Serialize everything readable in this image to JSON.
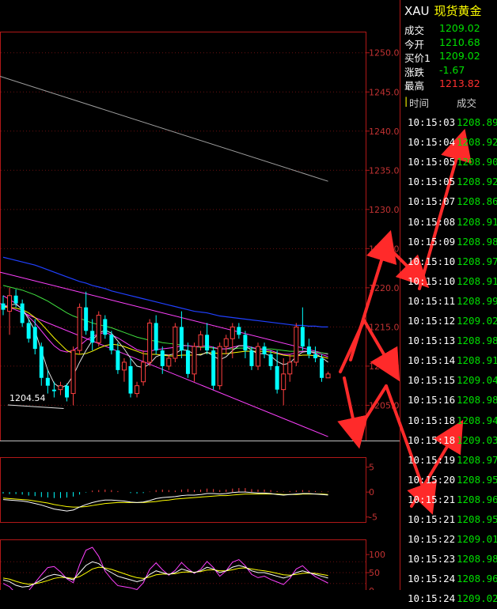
{
  "header": {
    "code": "XAU",
    "name": "现货黄金"
  },
  "quote": [
    {
      "label": "成交",
      "value": "1209.02",
      "color": "#00e000"
    },
    {
      "label": "今开",
      "value": "1210.68",
      "color": "#00e000"
    },
    {
      "label": "买价1",
      "value": "1209.02",
      "color": "#00e000"
    },
    {
      "label": "涨跌",
      "value": "-1.67",
      "color": "#00e000"
    },
    {
      "label": "最高",
      "value": "1213.82",
      "color": "#ff3030"
    }
  ],
  "trades_header": {
    "time": "时间",
    "price": "成交"
  },
  "trades": [
    {
      "time": "10:15:03",
      "price": "1208.89"
    },
    {
      "time": "10:15:04",
      "price": "1208.92"
    },
    {
      "time": "10:15:05",
      "price": "1208.90"
    },
    {
      "time": "10:15:05",
      "price": "1208.92"
    },
    {
      "time": "10:15:07",
      "price": "1208.86"
    },
    {
      "time": "10:15:08",
      "price": "1208.91"
    },
    {
      "time": "10:15:09",
      "price": "1208.98"
    },
    {
      "time": "10:15:10",
      "price": "1208.97"
    },
    {
      "time": "10:15:10",
      "price": "1208.91"
    },
    {
      "time": "10:15:11",
      "price": "1208.99"
    },
    {
      "time": "10:15:12",
      "price": "1209.02"
    },
    {
      "time": "10:15:13",
      "price": "1208.98"
    },
    {
      "time": "10:15:14",
      "price": "1208.91"
    },
    {
      "time": "10:15:15",
      "price": "1209.04"
    },
    {
      "time": "10:15:16",
      "price": "1208.98"
    },
    {
      "time": "10:15:18",
      "price": "1208.94"
    },
    {
      "time": "10:15:18",
      "price": "1209.03"
    },
    {
      "time": "10:15:19",
      "price": "1208.97"
    },
    {
      "time": "10:15:20",
      "price": "1208.95"
    },
    {
      "time": "10:15:21",
      "price": "1208.96"
    },
    {
      "time": "10:15:21",
      "price": "1208.95"
    },
    {
      "time": "10:15:22",
      "price": "1209.01"
    },
    {
      "time": "10:15:23",
      "price": "1208.98"
    },
    {
      "time": "10:15:24",
      "price": "1208.96"
    },
    {
      "time": "10:15:24",
      "price": "1209.02"
    }
  ],
  "chart_data": {
    "type": "candlestick",
    "price_axis": {
      "ticks": [
        "1250.0",
        "1245.0",
        "1240.0",
        "1235.0",
        "1230.0",
        "1225.0",
        "1220.0",
        "1215.0",
        "1210.0",
        "1205.0"
      ],
      "range": [
        1200.5,
        1252.7
      ]
    },
    "low_annotation": "1204.54",
    "macd_axis": {
      "ticks": [
        "5",
        "0",
        "-5"
      ]
    },
    "kdj_axis": {
      "ticks": [
        "100",
        "50",
        "0"
      ]
    },
    "colors": {
      "up": "#ff4040",
      "down": "#00ffff",
      "axis": "#b01818",
      "ma_white": "#e0e0e0",
      "ma_yellow": "#ffff00",
      "ma_green": "#40e040",
      "ma_blue": "#2040ff",
      "ma_magenta": "#ff40ff",
      "ma_grey": "#a0a0a0",
      "arrow": "#ff2a2a"
    },
    "candles": [
      {
        "o": 1218.0,
        "h": 1219.0,
        "l": 1216.5,
        "c": 1217.2
      },
      {
        "o": 1217.0,
        "h": 1220.0,
        "l": 1214.0,
        "c": 1219.0
      },
      {
        "o": 1219.0,
        "h": 1219.8,
        "l": 1217.5,
        "c": 1218.0
      },
      {
        "o": 1218.0,
        "h": 1218.5,
        "l": 1215.0,
        "c": 1215.5
      },
      {
        "o": 1215.5,
        "h": 1216.0,
        "l": 1213.0,
        "c": 1213.5
      },
      {
        "o": 1215.0,
        "h": 1216.0,
        "l": 1211.5,
        "c": 1212.2
      },
      {
        "o": 1212.5,
        "h": 1213.0,
        "l": 1207.5,
        "c": 1208.5
      },
      {
        "o": 1208.5,
        "h": 1209.5,
        "l": 1206.5,
        "c": 1207.5
      },
      {
        "o": 1207.0,
        "h": 1208.0,
        "l": 1206.0,
        "c": 1206.8
      },
      {
        "o": 1207.0,
        "h": 1208.0,
        "l": 1206.3,
        "c": 1207.5
      },
      {
        "o": 1207.5,
        "h": 1207.8,
        "l": 1205.5,
        "c": 1206.0
      },
      {
        "o": 1206.5,
        "h": 1212.5,
        "l": 1205.0,
        "c": 1212.0
      },
      {
        "o": 1212.0,
        "h": 1218.0,
        "l": 1211.5,
        "c": 1217.5
      },
      {
        "o": 1217.5,
        "h": 1219.5,
        "l": 1214.0,
        "c": 1214.5
      },
      {
        "o": 1214.5,
        "h": 1216.0,
        "l": 1212.0,
        "c": 1213.0
      },
      {
        "o": 1213.0,
        "h": 1217.0,
        "l": 1212.5,
        "c": 1216.5
      },
      {
        "o": 1216.0,
        "h": 1216.5,
        "l": 1213.5,
        "c": 1214.0
      },
      {
        "o": 1214.0,
        "h": 1214.5,
        "l": 1211.5,
        "c": 1212.0
      },
      {
        "o": 1212.0,
        "h": 1213.0,
        "l": 1209.0,
        "c": 1209.5
      },
      {
        "o": 1209.5,
        "h": 1211.0,
        "l": 1208.0,
        "c": 1210.5
      },
      {
        "o": 1210.0,
        "h": 1211.0,
        "l": 1206.0,
        "c": 1206.5
      },
      {
        "o": 1206.5,
        "h": 1208.0,
        "l": 1206.0,
        "c": 1207.5
      },
      {
        "o": 1208.0,
        "h": 1212.0,
        "l": 1207.5,
        "c": 1210.5
      },
      {
        "o": 1210.5,
        "h": 1216.0,
        "l": 1210.0,
        "c": 1215.5
      },
      {
        "o": 1215.5,
        "h": 1216.5,
        "l": 1211.5,
        "c": 1212.0
      },
      {
        "o": 1212.0,
        "h": 1212.5,
        "l": 1209.0,
        "c": 1210.0
      },
      {
        "o": 1210.0,
        "h": 1211.5,
        "l": 1209.5,
        "c": 1211.0
      },
      {
        "o": 1211.0,
        "h": 1215.5,
        "l": 1210.5,
        "c": 1215.0
      },
      {
        "o": 1215.0,
        "h": 1217.0,
        "l": 1211.0,
        "c": 1212.0
      },
      {
        "o": 1212.0,
        "h": 1213.0,
        "l": 1208.5,
        "c": 1209.0
      },
      {
        "o": 1209.0,
        "h": 1213.0,
        "l": 1208.0,
        "c": 1212.5
      },
      {
        "o": 1212.5,
        "h": 1214.5,
        "l": 1212.0,
        "c": 1214.0
      },
      {
        "o": 1214.0,
        "h": 1215.5,
        "l": 1211.5,
        "c": 1212.0
      },
      {
        "o": 1212.0,
        "h": 1212.5,
        "l": 1207.0,
        "c": 1207.5
      },
      {
        "o": 1207.5,
        "h": 1213.0,
        "l": 1207.0,
        "c": 1212.5
      },
      {
        "o": 1212.5,
        "h": 1214.0,
        "l": 1211.5,
        "c": 1213.5
      },
      {
        "o": 1213.5,
        "h": 1215.5,
        "l": 1211.0,
        "c": 1215.0
      },
      {
        "o": 1215.0,
        "h": 1215.5,
        "l": 1213.5,
        "c": 1214.0
      },
      {
        "o": 1214.0,
        "h": 1214.5,
        "l": 1211.0,
        "c": 1212.0
      },
      {
        "o": 1212.0,
        "h": 1212.5,
        "l": 1209.5,
        "c": 1210.0
      },
      {
        "o": 1210.0,
        "h": 1213.0,
        "l": 1209.5,
        "c": 1212.5
      },
      {
        "o": 1212.5,
        "h": 1213.0,
        "l": 1211.0,
        "c": 1211.5
      },
      {
        "o": 1211.5,
        "h": 1212.0,
        "l": 1209.5,
        "c": 1210.0
      },
      {
        "o": 1210.0,
        "h": 1212.0,
        "l": 1206.5,
        "c": 1207.0
      },
      {
        "o": 1207.0,
        "h": 1211.0,
        "l": 1205.0,
        "c": 1209.0
      },
      {
        "o": 1209.0,
        "h": 1211.5,
        "l": 1208.0,
        "c": 1210.5
      },
      {
        "o": 1210.5,
        "h": 1215.5,
        "l": 1210.0,
        "c": 1215.0
      },
      {
        "o": 1215.0,
        "h": 1217.5,
        "l": 1212.0,
        "c": 1212.5
      },
      {
        "o": 1212.5,
        "h": 1213.5,
        "l": 1211.0,
        "c": 1211.5
      },
      {
        "o": 1211.5,
        "h": 1212.5,
        "l": 1210.5,
        "c": 1211.0
      },
      {
        "o": 1211.0,
        "h": 1211.5,
        "l": 1208.0,
        "c": 1208.5
      },
      {
        "o": 1208.5,
        "h": 1209.3,
        "l": 1208.5,
        "c": 1209.0
      }
    ],
    "ma_white": [
      1217.5,
      1217.8,
      1217.9,
      1217.3,
      1216.0,
      1214.5,
      1212.0,
      1209.5,
      1207.8,
      1207.2,
      1207.6,
      1208.8,
      1210.5,
      1212.0,
      1213.3,
      1214.2,
      1214.6,
      1214.2,
      1213.2,
      1212.2,
      1211.0,
      1210.0,
      1209.8,
      1210.3,
      1211.2,
      1211.5,
      1211.4,
      1211.6,
      1212.1,
      1212.0,
      1211.5,
      1211.4,
      1211.8,
      1211.3,
      1210.8,
      1211.2,
      1212.0,
      1212.6,
      1212.6,
      1212.0,
      1211.6,
      1211.6,
      1211.3,
      1210.6,
      1210.2,
      1210.4,
      1211.2,
      1211.8,
      1211.9,
      1211.6,
      1211.1,
      1210.5
    ],
    "ma_yellow": [
      1217.5,
      1217.5,
      1217.4,
      1217.2,
      1216.8,
      1216.2,
      1215.4,
      1214.5,
      1213.6,
      1212.8,
      1212.0,
      1211.6,
      1211.5,
      1211.6,
      1211.9,
      1212.3,
      1212.6,
      1212.8,
      1212.7,
      1212.5,
      1212.2,
      1211.9,
      1211.6,
      1211.5,
      1211.5,
      1211.4,
      1211.3,
      1211.3,
      1211.4,
      1211.4,
      1211.4,
      1211.5,
      1211.7,
      1211.7,
      1211.6,
      1211.6,
      1211.7,
      1211.8,
      1211.9,
      1211.9,
      1211.9,
      1211.9,
      1211.8,
      1211.6,
      1211.4,
      1211.3,
      1211.3,
      1211.4,
      1211.4,
      1211.3,
      1211.2,
      1211.0
    ],
    "ma_green": [
      1220.3,
      1220.1,
      1219.9,
      1219.7,
      1219.4,
      1219.1,
      1218.7,
      1218.3,
      1217.8,
      1217.3,
      1216.8,
      1216.4,
      1216.1,
      1215.8,
      1215.5,
      1215.3,
      1215.1,
      1214.9,
      1214.6,
      1214.3,
      1214.0,
      1213.7,
      1213.5,
      1213.3,
      1213.2,
      1213.0,
      1212.9,
      1212.8,
      1212.7,
      1212.6,
      1212.5,
      1212.4,
      1212.4,
      1212.3,
      1212.2,
      1212.2,
      1212.2,
      1212.3,
      1212.3,
      1212.3,
      1212.2,
      1212.2,
      1212.2,
      1212.1,
      1212.0,
      1211.9,
      1211.9,
      1211.9,
      1211.9,
      1211.8,
      1211.7,
      1211.6
    ],
    "ma_blue": [
      1223.9,
      1223.7,
      1223.5,
      1223.3,
      1223.1,
      1222.9,
      1222.6,
      1222.3,
      1222.0,
      1221.7,
      1221.4,
      1221.1,
      1220.8,
      1220.6,
      1220.3,
      1220.1,
      1219.9,
      1219.6,
      1219.4,
      1219.2,
      1219.0,
      1218.8,
      1218.6,
      1218.4,
      1218.2,
      1218.0,
      1217.8,
      1217.6,
      1217.4,
      1217.2,
      1217.0,
      1216.9,
      1216.8,
      1216.6,
      1216.4,
      1216.3,
      1216.2,
      1216.1,
      1216.0,
      1215.9,
      1215.8,
      1215.7,
      1215.6,
      1215.5,
      1215.4,
      1215.3,
      1215.2,
      1215.2,
      1215.1,
      1215.1,
      1215.0,
      1215.0
    ],
    "ma_magenta": [
      1219.0,
      1218.5,
      1218.0,
      1217.2,
      1216.3,
      1215.5,
      1214.5,
      1213.5,
      1212.6,
      1212.0,
      1211.8,
      1212.0,
      1212.6,
      1213.3,
      1213.8,
      1214.1,
      1214.3,
      1214.0,
      1213.6,
      1213.1,
      1212.6,
      1212.1,
      1211.9,
      1211.9,
      1212.1,
      1212.2,
      1212.3,
      1212.4,
      1212.6,
      1212.6,
      1212.5,
      1212.5,
      1212.6,
      1212.4,
      1212.2,
      1212.2,
      1212.4,
      1212.6,
      1212.6,
      1212.4,
      1212.2,
      1212.1,
      1212.0,
      1211.7,
      1211.5,
      1211.5,
      1211.7,
      1211.9,
      1211.9,
      1211.7,
      1211.5,
      1211.2
    ],
    "ma_grey_line": [
      {
        "x": 0,
        "y": 1247.0
      },
      {
        "x": 51,
        "y": 1233.6
      }
    ],
    "trendlines": [
      {
        "color": "#ff40ff",
        "from": {
          "x": 0,
          "y": 1222.0
        },
        "to": {
          "x": 51,
          "y": 1211.5
        }
      },
      {
        "color": "#ff40ff",
        "from": {
          "x": 0,
          "y": 1218.0
        },
        "to": {
          "x": 51,
          "y": 1201.0
        }
      }
    ],
    "macd_hist": [
      -0.3,
      -0.4,
      -0.4,
      -0.5,
      -0.7,
      -0.8,
      -1.0,
      -1.1,
      -1.2,
      -1.2,
      -1.1,
      -0.9,
      -0.5,
      -0.1,
      0.3,
      0.4,
      0.5,
      0.4,
      0.2,
      0.0,
      -0.2,
      -0.3,
      -0.2,
      0.1,
      0.4,
      0.5,
      0.4,
      0.3,
      0.5,
      0.6,
      0.4,
      0.5,
      0.7,
      0.6,
      0.4,
      0.5,
      0.7,
      0.8,
      0.8,
      0.6,
      0.5,
      0.5,
      0.4,
      0.2,
      0.1,
      0.2,
      0.3,
      0.4,
      0.3,
      0.2,
      0.1,
      0.1
    ],
    "macd_dif": [
      -1.5,
      -1.6,
      -1.7,
      -1.8,
      -2.0,
      -2.3,
      -2.6,
      -3.0,
      -3.4,
      -3.6,
      -3.8,
      -3.6,
      -3.0,
      -2.5,
      -2.1,
      -1.8,
      -1.6,
      -1.6,
      -1.7,
      -1.8,
      -2.0,
      -2.1,
      -2.0,
      -1.7,
      -1.3,
      -1.1,
      -1.0,
      -0.9,
      -0.7,
      -0.6,
      -0.6,
      -0.5,
      -0.3,
      -0.3,
      -0.4,
      -0.3,
      -0.1,
      0.0,
      0.0,
      -0.1,
      -0.2,
      -0.2,
      -0.3,
      -0.5,
      -0.6,
      -0.5,
      -0.4,
      -0.3,
      -0.3,
      -0.4,
      -0.5,
      -0.6
    ],
    "macd_dea": [
      -1.2,
      -1.3,
      -1.4,
      -1.5,
      -1.6,
      -1.8,
      -2.0,
      -2.2,
      -2.5,
      -2.7,
      -2.9,
      -3.0,
      -3.0,
      -2.9,
      -2.7,
      -2.5,
      -2.3,
      -2.2,
      -2.1,
      -2.1,
      -2.1,
      -2.1,
      -2.1,
      -2.0,
      -1.9,
      -1.7,
      -1.6,
      -1.4,
      -1.3,
      -1.2,
      -1.1,
      -1.0,
      -0.9,
      -0.8,
      -0.7,
      -0.7,
      -0.6,
      -0.5,
      -0.4,
      -0.4,
      -0.4,
      -0.4,
      -0.4,
      -0.4,
      -0.5,
      -0.5,
      -0.5,
      -0.4,
      -0.4,
      -0.4,
      -0.4,
      -0.5
    ],
    "kdj_k": [
      30,
      25,
      15,
      10,
      12,
      20,
      30,
      40,
      45,
      42,
      35,
      30,
      50,
      70,
      80,
      75,
      60,
      50,
      40,
      35,
      30,
      25,
      30,
      45,
      55,
      50,
      45,
      50,
      60,
      55,
      50,
      55,
      65,
      60,
      50,
      55,
      65,
      70,
      65,
      55,
      50,
      50,
      45,
      40,
      35,
      40,
      50,
      55,
      50,
      45,
      40,
      35
    ],
    "kdj_d": [
      35,
      32,
      26,
      21,
      18,
      19,
      23,
      28,
      34,
      37,
      36,
      34,
      39,
      49,
      60,
      65,
      63,
      59,
      53,
      47,
      41,
      36,
      34,
      38,
      44,
      46,
      46,
      47,
      51,
      52,
      51,
      53,
      57,
      58,
      55,
      55,
      58,
      62,
      63,
      60,
      57,
      55,
      52,
      48,
      44,
      43,
      45,
      48,
      49,
      48,
      45,
      42
    ],
    "kdj_j": [
      20,
      11,
      -7,
      -12,
      0,
      22,
      44,
      64,
      67,
      52,
      33,
      22,
      72,
      112,
      120,
      95,
      54,
      32,
      14,
      11,
      8,
      3,
      22,
      59,
      77,
      58,
      43,
      56,
      78,
      61,
      48,
      59,
      81,
      64,
      40,
      55,
      79,
      86,
      69,
      45,
      36,
      40,
      31,
      24,
      17,
      34,
      60,
      69,
      52,
      39,
      30,
      21
    ],
    "kdj_ref_lines": [
      50,
      80,
      20
    ]
  }
}
